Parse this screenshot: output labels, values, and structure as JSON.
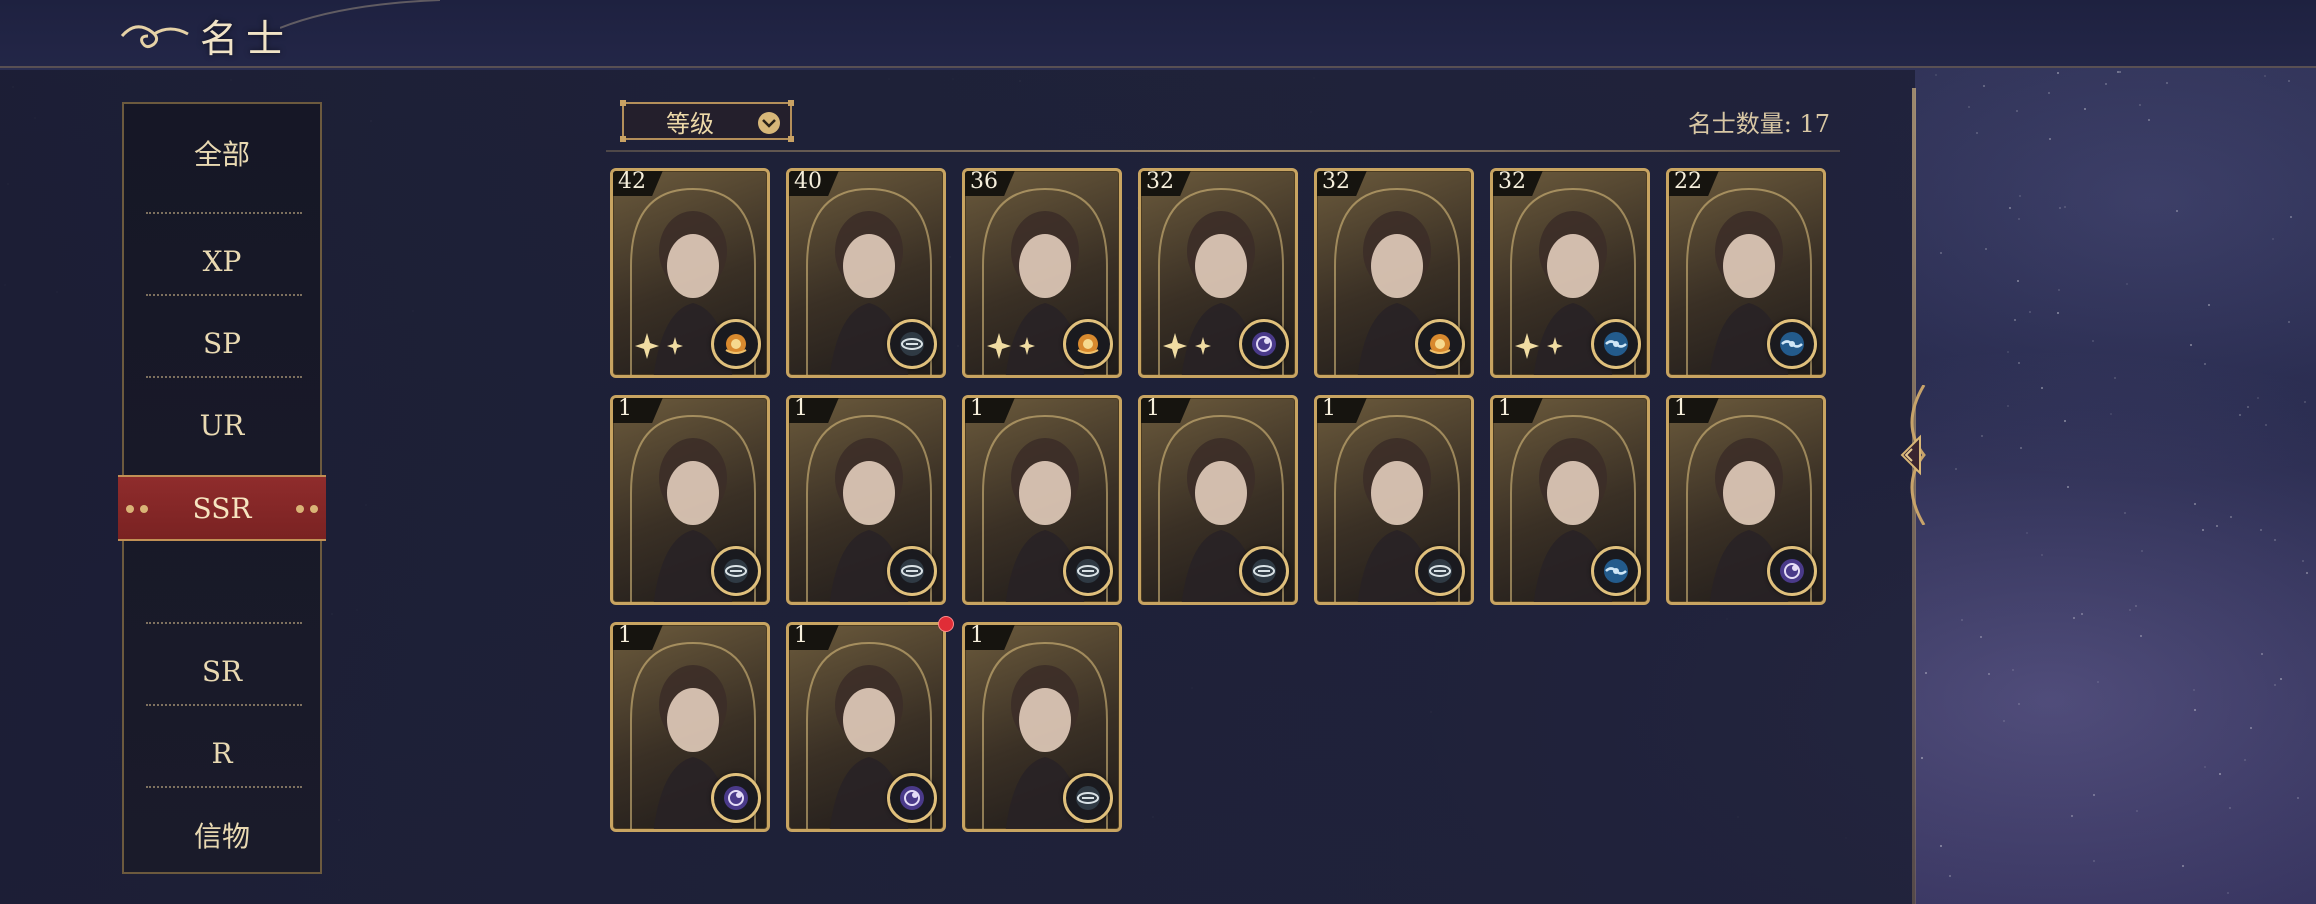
{
  "header": {
    "title": "名士"
  },
  "sidebar": {
    "items": [
      {
        "label": "全部"
      },
      {
        "label": "XP"
      },
      {
        "label": "SP"
      },
      {
        "label": "UR"
      },
      {
        "label": "SSR"
      },
      {
        "label": "SR"
      },
      {
        "label": "R"
      },
      {
        "label": "信物"
      }
    ],
    "active_index": 4
  },
  "filter": {
    "sort_label": "等级"
  },
  "count_text": "名士数量: 17",
  "colors": {
    "accent_gold": "#c8a461",
    "active_red": "#8f2c2c",
    "notification_red": "#e02d37"
  },
  "cards": [
    {
      "level": "42",
      "badge": "sun-orb-icon",
      "badge_color": "#d8892e",
      "has_sparkle": true
    },
    {
      "level": "40",
      "badge": "compass-eye-icon",
      "badge_color": "#2f3a44",
      "has_sparkle": false
    },
    {
      "level": "36",
      "badge": "sun-orb-icon",
      "badge_color": "#d8892e",
      "has_sparkle": true
    },
    {
      "level": "32",
      "badge": "crescent-orb-icon",
      "badge_color": "#4a3a8a",
      "has_sparkle": true
    },
    {
      "level": "32",
      "badge": "sun-orb-icon",
      "badge_color": "#d8892e",
      "has_sparkle": false
    },
    {
      "level": "32",
      "badge": "water-orb-icon",
      "badge_color": "#235b8c",
      "has_sparkle": true
    },
    {
      "level": "22",
      "badge": "water-orb-icon",
      "badge_color": "#235b8c",
      "has_sparkle": false
    },
    {
      "level": "1",
      "badge": "compass-eye-icon",
      "badge_color": "#2f3a44",
      "has_sparkle": false
    },
    {
      "level": "1",
      "badge": "compass-eye-icon",
      "badge_color": "#2f3a44",
      "has_sparkle": false
    },
    {
      "level": "1",
      "badge": "compass-eye-icon",
      "badge_color": "#2f3a44",
      "has_sparkle": false
    },
    {
      "level": "1",
      "badge": "compass-eye-icon",
      "badge_color": "#2f3a44",
      "has_sparkle": false
    },
    {
      "level": "1",
      "badge": "compass-eye-icon",
      "badge_color": "#2f3a44",
      "has_sparkle": false
    },
    {
      "level": "1",
      "badge": "water-orb-icon",
      "badge_color": "#235b8c",
      "has_sparkle": false
    },
    {
      "level": "1",
      "badge": "crescent-orb-icon",
      "badge_color": "#4a3a8a",
      "has_sparkle": false
    },
    {
      "level": "1",
      "badge": "crescent-orb-icon",
      "badge_color": "#4a3a8a",
      "has_sparkle": false
    },
    {
      "level": "1",
      "badge": "crescent-orb-icon",
      "badge_color": "#4a3a8a",
      "has_sparkle": false,
      "notification": true
    },
    {
      "level": "1",
      "badge": "compass-eye-icon",
      "badge_color": "#2f3a44",
      "has_sparkle": false
    }
  ]
}
